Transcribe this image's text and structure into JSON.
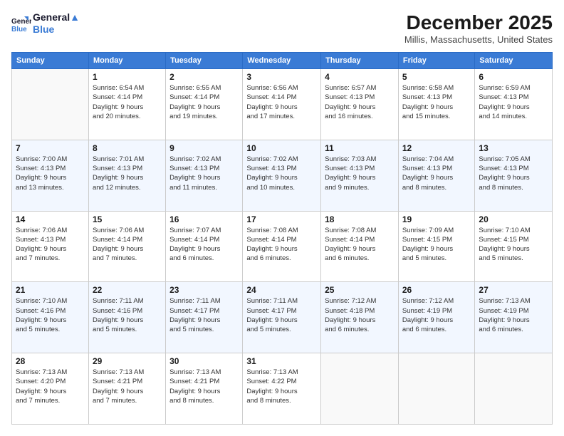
{
  "logo": {
    "line1": "General",
    "line2": "Blue"
  },
  "title": "December 2025",
  "location": "Millis, Massachusetts, United States",
  "headers": [
    "Sunday",
    "Monday",
    "Tuesday",
    "Wednesday",
    "Thursday",
    "Friday",
    "Saturday"
  ],
  "rows": [
    [
      {
        "num": "",
        "info": ""
      },
      {
        "num": "1",
        "info": "Sunrise: 6:54 AM\nSunset: 4:14 PM\nDaylight: 9 hours\nand 20 minutes."
      },
      {
        "num": "2",
        "info": "Sunrise: 6:55 AM\nSunset: 4:14 PM\nDaylight: 9 hours\nand 19 minutes."
      },
      {
        "num": "3",
        "info": "Sunrise: 6:56 AM\nSunset: 4:14 PM\nDaylight: 9 hours\nand 17 minutes."
      },
      {
        "num": "4",
        "info": "Sunrise: 6:57 AM\nSunset: 4:13 PM\nDaylight: 9 hours\nand 16 minutes."
      },
      {
        "num": "5",
        "info": "Sunrise: 6:58 AM\nSunset: 4:13 PM\nDaylight: 9 hours\nand 15 minutes."
      },
      {
        "num": "6",
        "info": "Sunrise: 6:59 AM\nSunset: 4:13 PM\nDaylight: 9 hours\nand 14 minutes."
      }
    ],
    [
      {
        "num": "7",
        "info": "Sunrise: 7:00 AM\nSunset: 4:13 PM\nDaylight: 9 hours\nand 13 minutes."
      },
      {
        "num": "8",
        "info": "Sunrise: 7:01 AM\nSunset: 4:13 PM\nDaylight: 9 hours\nand 12 minutes."
      },
      {
        "num": "9",
        "info": "Sunrise: 7:02 AM\nSunset: 4:13 PM\nDaylight: 9 hours\nand 11 minutes."
      },
      {
        "num": "10",
        "info": "Sunrise: 7:02 AM\nSunset: 4:13 PM\nDaylight: 9 hours\nand 10 minutes."
      },
      {
        "num": "11",
        "info": "Sunrise: 7:03 AM\nSunset: 4:13 PM\nDaylight: 9 hours\nand 9 minutes."
      },
      {
        "num": "12",
        "info": "Sunrise: 7:04 AM\nSunset: 4:13 PM\nDaylight: 9 hours\nand 8 minutes."
      },
      {
        "num": "13",
        "info": "Sunrise: 7:05 AM\nSunset: 4:13 PM\nDaylight: 9 hours\nand 8 minutes."
      }
    ],
    [
      {
        "num": "14",
        "info": "Sunrise: 7:06 AM\nSunset: 4:13 PM\nDaylight: 9 hours\nand 7 minutes."
      },
      {
        "num": "15",
        "info": "Sunrise: 7:06 AM\nSunset: 4:14 PM\nDaylight: 9 hours\nand 7 minutes."
      },
      {
        "num": "16",
        "info": "Sunrise: 7:07 AM\nSunset: 4:14 PM\nDaylight: 9 hours\nand 6 minutes."
      },
      {
        "num": "17",
        "info": "Sunrise: 7:08 AM\nSunset: 4:14 PM\nDaylight: 9 hours\nand 6 minutes."
      },
      {
        "num": "18",
        "info": "Sunrise: 7:08 AM\nSunset: 4:14 PM\nDaylight: 9 hours\nand 6 minutes."
      },
      {
        "num": "19",
        "info": "Sunrise: 7:09 AM\nSunset: 4:15 PM\nDaylight: 9 hours\nand 5 minutes."
      },
      {
        "num": "20",
        "info": "Sunrise: 7:10 AM\nSunset: 4:15 PM\nDaylight: 9 hours\nand 5 minutes."
      }
    ],
    [
      {
        "num": "21",
        "info": "Sunrise: 7:10 AM\nSunset: 4:16 PM\nDaylight: 9 hours\nand 5 minutes."
      },
      {
        "num": "22",
        "info": "Sunrise: 7:11 AM\nSunset: 4:16 PM\nDaylight: 9 hours\nand 5 minutes."
      },
      {
        "num": "23",
        "info": "Sunrise: 7:11 AM\nSunset: 4:17 PM\nDaylight: 9 hours\nand 5 minutes."
      },
      {
        "num": "24",
        "info": "Sunrise: 7:11 AM\nSunset: 4:17 PM\nDaylight: 9 hours\nand 5 minutes."
      },
      {
        "num": "25",
        "info": "Sunrise: 7:12 AM\nSunset: 4:18 PM\nDaylight: 9 hours\nand 6 minutes."
      },
      {
        "num": "26",
        "info": "Sunrise: 7:12 AM\nSunset: 4:19 PM\nDaylight: 9 hours\nand 6 minutes."
      },
      {
        "num": "27",
        "info": "Sunrise: 7:13 AM\nSunset: 4:19 PM\nDaylight: 9 hours\nand 6 minutes."
      }
    ],
    [
      {
        "num": "28",
        "info": "Sunrise: 7:13 AM\nSunset: 4:20 PM\nDaylight: 9 hours\nand 7 minutes."
      },
      {
        "num": "29",
        "info": "Sunrise: 7:13 AM\nSunset: 4:21 PM\nDaylight: 9 hours\nand 7 minutes."
      },
      {
        "num": "30",
        "info": "Sunrise: 7:13 AM\nSunset: 4:21 PM\nDaylight: 9 hours\nand 8 minutes."
      },
      {
        "num": "31",
        "info": "Sunrise: 7:13 AM\nSunset: 4:22 PM\nDaylight: 9 hours\nand 8 minutes."
      },
      {
        "num": "",
        "info": ""
      },
      {
        "num": "",
        "info": ""
      },
      {
        "num": "",
        "info": ""
      }
    ]
  ]
}
